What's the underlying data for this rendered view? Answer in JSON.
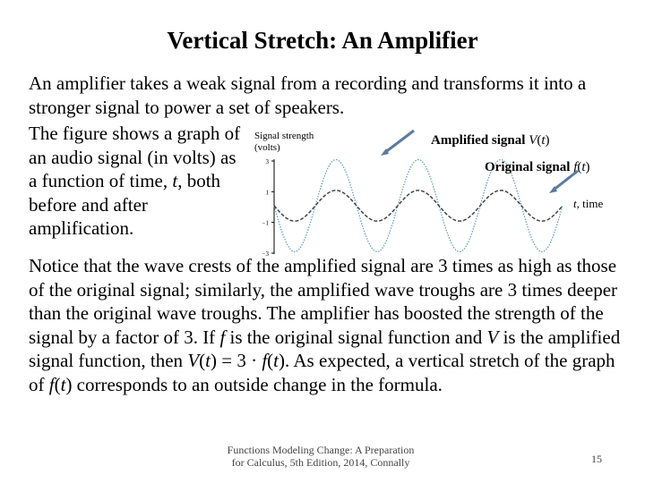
{
  "slide": {
    "title": "Vertical Stretch: An Amplifier",
    "intro": "An amplifier takes a weak signal from a recording and transforms it into a stronger signal to power a set of speakers.",
    "side_text": {
      "before_t": "The figure shows a graph of an audio signal (in volts) as a function of time, ",
      "t": "t",
      "after_t": ", both before and after amplification."
    },
    "body": {
      "p1": "Notice that the wave crests of the amplified signal are 3 times as high as those of the original signal; similarly, the amplified wave troughs are 3 times deeper than the original wave troughs. The amplifier has boosted the strength of the signal by a factor of 3. If ",
      "f1": "f",
      "p2": " is the original signal function and ",
      "V1": "V",
      "p3": " is the amplified signal function, then ",
      "V2": "V",
      "p4": "(",
      "t1": "t",
      "p5": ") = 3 · ",
      "f2": "f",
      "p6": "(",
      "t2": "t",
      "p7": "). As expected, a vertical stretch of the graph of ",
      "f3": "f",
      "p8": "(",
      "t3": "t",
      "p9": ") corresponds to an outside change in the formula."
    },
    "footer": {
      "citation_line1": "Functions Modeling Change: A Preparation",
      "citation_line2": "for Calculus, 5th Edition, 2014, Connally",
      "page_number": "15"
    }
  },
  "chart_data": {
    "type": "line",
    "title": "",
    "ylabel_line1": "Signal strength",
    "ylabel_line2": "(volts)",
    "xlabel": "t, time",
    "xlabel_var": "t",
    "xlabel_rest": ", time",
    "ylim": [
      -3,
      3
    ],
    "yticks": [
      3,
      1,
      -1,
      -1,
      -3
    ],
    "ytick_labels": [
      "3",
      "1",
      "−1",
      "−3"
    ],
    "ytick_values": [
      3,
      1,
      -1,
      -3
    ],
    "periods": 3.5,
    "series": [
      {
        "name": "Amplified signal V(t)",
        "label_text": "Amplified signal ",
        "label_fn": "V",
        "amplitude": 3,
        "style": "dotted",
        "color": "#5f9ea8"
      },
      {
        "name": "Original signal f(t)",
        "label_text": "Original signal ",
        "label_fn": "f",
        "amplitude": 1,
        "style": "dashed",
        "color": "#444444"
      }
    ],
    "arrow_color": "#5b7a9d"
  }
}
